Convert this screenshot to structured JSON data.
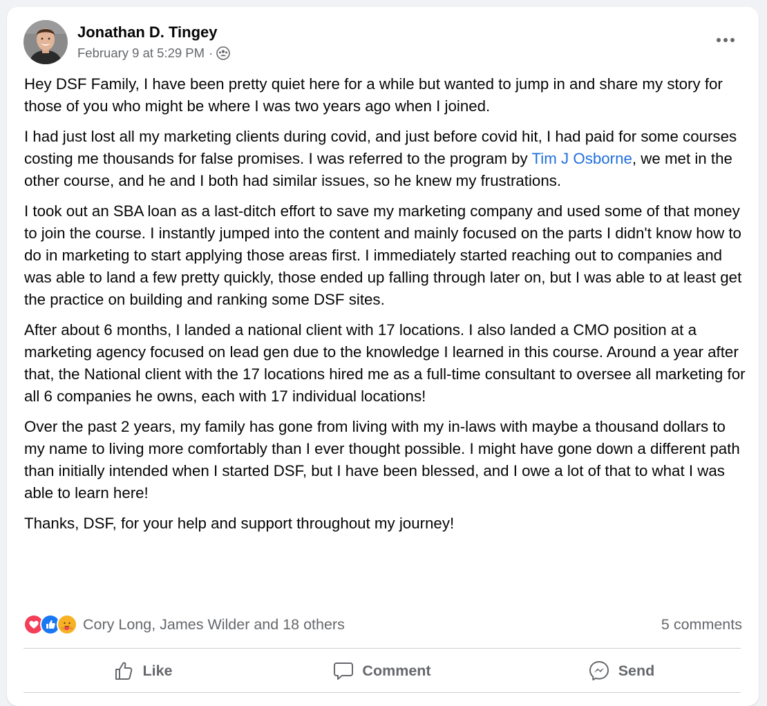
{
  "post": {
    "author": "Jonathan D. Tingey",
    "timestamp": "February 9 at 5:29 PM",
    "separator": "·",
    "audience_icon": "group-audience-icon",
    "paragraphs": {
      "p1": "Hey DSF Family, I have been pretty quiet here for a while but wanted to jump in and share my story for those of you who might be where I was two years ago when I joined.",
      "p2_before": "I had just lost all my marketing clients during covid, and just before covid hit, I had paid for some courses costing me thousands for false promises. I was referred to the program by ",
      "p2_mention": "Tim J Osborne",
      "p2_after": ", we met in the other course, and he and I both had similar issues, so he knew my frustrations.",
      "p3": "I took out an SBA loan as a last-ditch effort to save my marketing company and used some of that money to join the course. I instantly jumped into the content and mainly focused on the parts I didn't know how to do in marketing to start applying those areas first. I immediately started reaching out to companies and was able to land a few pretty quickly, those ended up falling through later on, but I was able to at least get the practice on building and ranking some DSF sites.",
      "p4": "After about 6  months, I landed a national client with 17 locations. I also landed a CMO position at a marketing agency focused on lead gen due to the knowledge I learned in this course. Around a year after that, the National client with the 17 locations hired me as a full-time consultant to oversee all marketing for all 6 companies he owns, each with 17 individual locations!",
      "p5": "Over the past 2 years, my family has gone from living with my in-laws with maybe a thousand dollars to my name to living more comfortably than I ever thought possible. I might have gone down a different path than initially intended when I started DSF, but I have been blessed, and I owe a lot of that to what I was able to learn here!",
      "p6": "Thanks, DSF, for your help and support throughout my journey!"
    }
  },
  "reactions": {
    "icons": [
      "love-reaction-icon",
      "like-reaction-icon",
      "care-reaction-icon"
    ],
    "summary": "Cory Long, James Wilder and 18 others",
    "comments": "5 comments"
  },
  "actions": {
    "like": "Like",
    "comment": "Comment",
    "send": "Send"
  },
  "colors": {
    "link": "#216fdb",
    "secondary_text": "#65676b",
    "love": "#f33e58",
    "like": "#1877f2",
    "care": "#f7b125"
  }
}
